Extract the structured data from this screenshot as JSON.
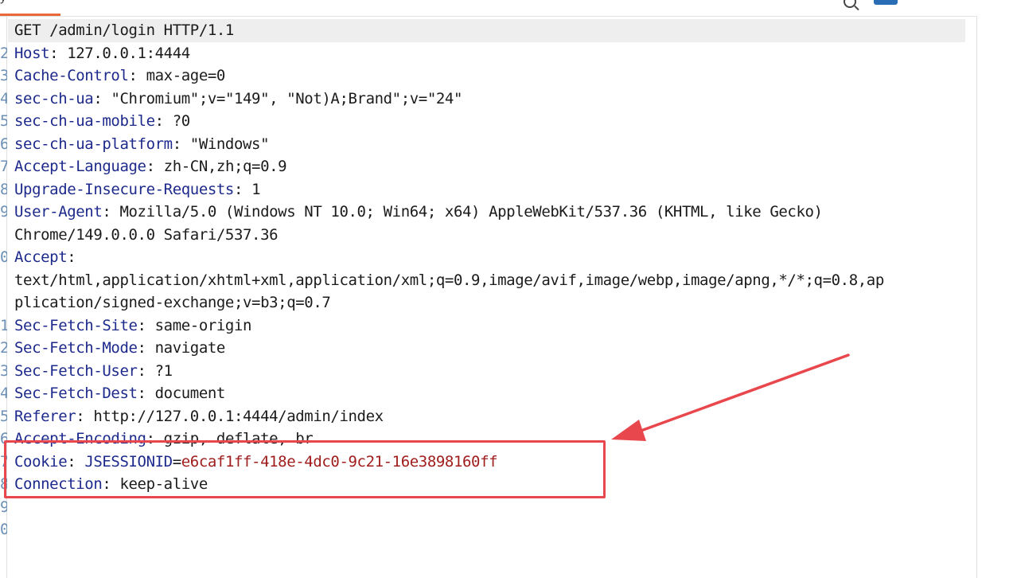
{
  "tab": {
    "label": "y"
  },
  "request_lines": [
    {
      "name": "GET /admin/login HTTP/1.1",
      "value": ""
    },
    {
      "name": "Host",
      "value": "127.0.0.1:4444"
    },
    {
      "name": "Cache-Control",
      "value": "max-age=0"
    },
    {
      "name": "sec-ch-ua",
      "value": "\"Chromium\";v=\"149\", \"Not)A;Brand\";v=\"24\""
    },
    {
      "name": "sec-ch-ua-mobile",
      "value": "?0"
    },
    {
      "name": "sec-ch-ua-platform",
      "value": "\"Windows\""
    },
    {
      "name": "Accept-Language",
      "value": "zh-CN,zh;q=0.9"
    },
    {
      "name": "Upgrade-Insecure-Requests",
      "value": "1"
    },
    {
      "name": "User-Agent",
      "value": "Mozilla/5.0 (Windows NT 10.0; Win64; x64) AppleWebKit/537.36 (KHTML, like Gecko)"
    },
    {
      "name": "",
      "value": "Chrome/149.0.0.0 Safari/537.36"
    },
    {
      "name": "Accept",
      "value": ""
    },
    {
      "name": "",
      "value": "text/html,application/xhtml+xml,application/xml;q=0.9,image/avif,image/webp,image/apng,*/*;q=0.8,ap"
    },
    {
      "name": "",
      "value": "plication/signed-exchange;v=b3;q=0.7"
    },
    {
      "name": "Sec-Fetch-Site",
      "value": "same-origin"
    },
    {
      "name": "Sec-Fetch-Mode",
      "value": "navigate"
    },
    {
      "name": "Sec-Fetch-User",
      "value": "?1"
    },
    {
      "name": "Sec-Fetch-Dest",
      "value": "document"
    },
    {
      "name": "Referer",
      "value": "http://127.0.0.1:4444/admin/index"
    },
    {
      "name": "Accept-Encoding",
      "value": "gzip, deflate, br"
    },
    {
      "name": "Cookie",
      "value": ""
    },
    {
      "name": "Connection",
      "value": "keep-alive"
    }
  ],
  "cookie": {
    "key": "JSESSIONID",
    "value": "e6caf1ff-418e-4dc0-9c21-16e3898160ff"
  },
  "gutter_numbers": [
    "",
    "2",
    "3",
    "4",
    "5",
    "6",
    "7",
    "8",
    "9",
    "",
    "0",
    "",
    "",
    "1",
    "2",
    "3",
    "4",
    "5",
    "6",
    "7",
    "8",
    "9",
    "0"
  ],
  "colors": {
    "header_name": "#1d2a8c",
    "cookie_value": "#a01d1d",
    "annotation": "#e8484d",
    "tab_accent": "#e8693a"
  }
}
